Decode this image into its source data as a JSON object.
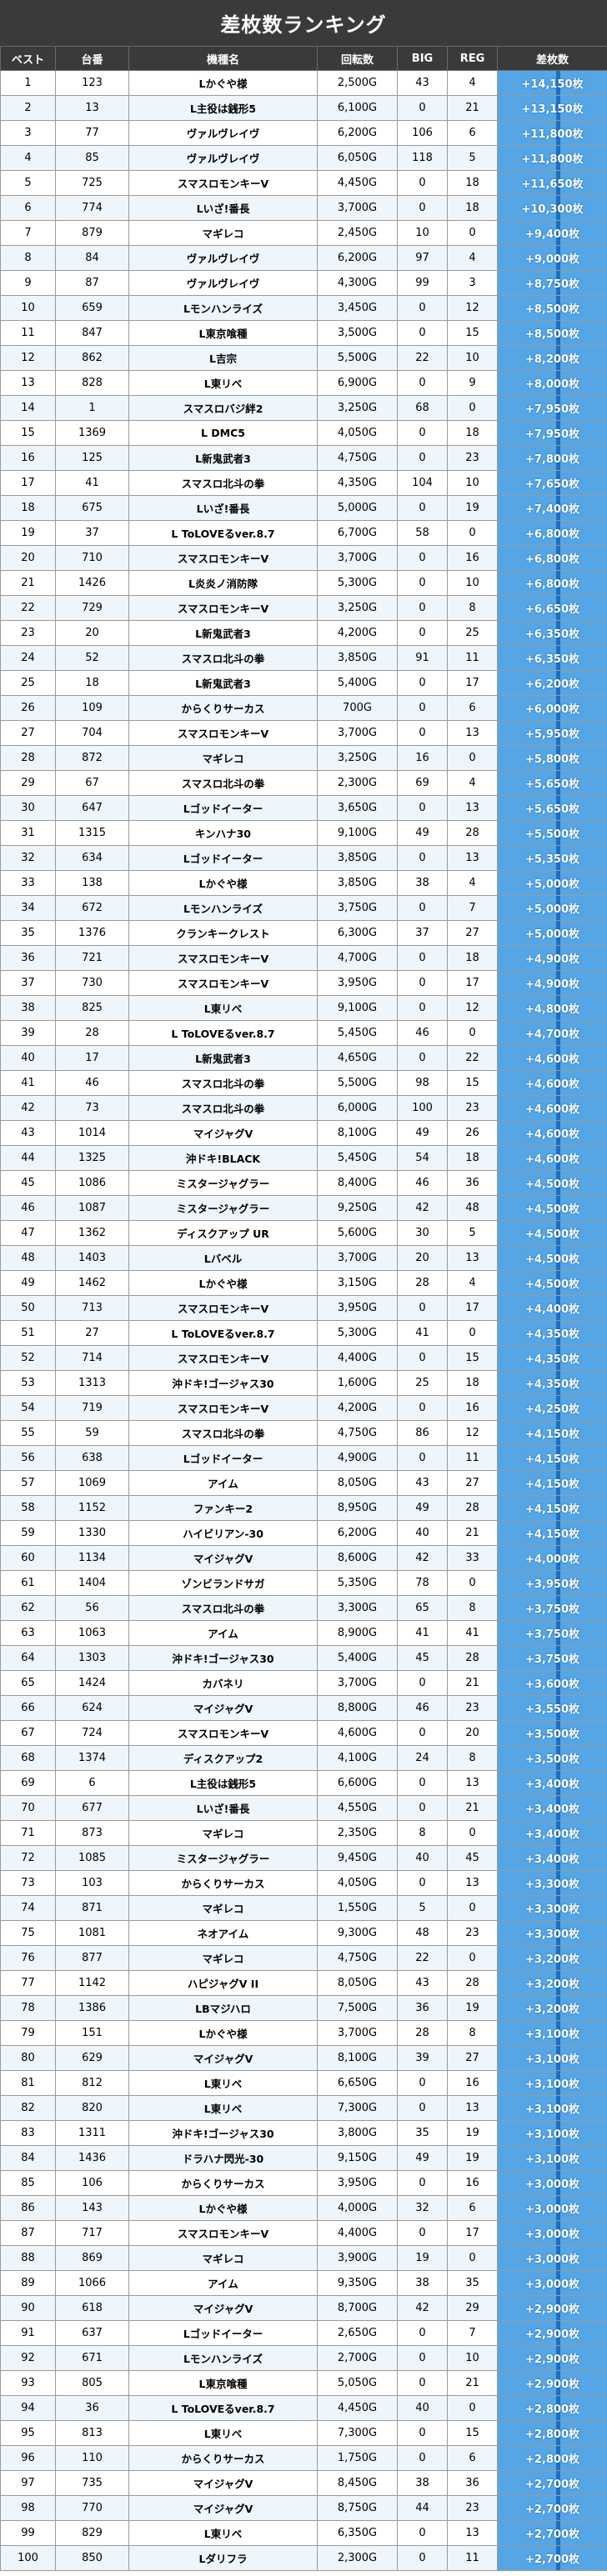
{
  "title": "差枚数ランキング",
  "headers": [
    "ベスト",
    "台番",
    "機種名",
    "回転数",
    "BIG",
    "REG",
    "差枚数"
  ],
  "colors": {
    "header_bg": "#3a3a3a",
    "diff_bg": "#56a6e6",
    "diff_marker": "#1f6fbf",
    "row_alt": "#eef5fb"
  },
  "rows": [
    [
      "1",
      "123",
      "Lかぐや様",
      "2,500G",
      "43",
      "4",
      "+14,150枚"
    ],
    [
      "2",
      "13",
      "L主役は銭形5",
      "6,100G",
      "0",
      "21",
      "+13,150枚"
    ],
    [
      "3",
      "77",
      "ヴァルヴレイヴ",
      "6,200G",
      "106",
      "6",
      "+11,800枚"
    ],
    [
      "4",
      "85",
      "ヴァルヴレイヴ",
      "6,050G",
      "118",
      "5",
      "+11,800枚"
    ],
    [
      "5",
      "725",
      "スマスロモンキーV",
      "4,450G",
      "0",
      "18",
      "+11,650枚"
    ],
    [
      "6",
      "774",
      "Lいざ!番長",
      "3,700G",
      "0",
      "18",
      "+10,300枚"
    ],
    [
      "7",
      "879",
      "マギレコ",
      "2,450G",
      "10",
      "0",
      "+9,400枚"
    ],
    [
      "8",
      "84",
      "ヴァルヴレイヴ",
      "6,200G",
      "97",
      "4",
      "+9,000枚"
    ],
    [
      "9",
      "87",
      "ヴァルヴレイヴ",
      "4,300G",
      "99",
      "3",
      "+8,750枚"
    ],
    [
      "10",
      "659",
      "Lモンハンライズ",
      "3,450G",
      "0",
      "12",
      "+8,500枚"
    ],
    [
      "11",
      "847",
      "L東京喰種",
      "3,500G",
      "0",
      "15",
      "+8,500枚"
    ],
    [
      "12",
      "862",
      "L吉宗",
      "5,500G",
      "22",
      "10",
      "+8,200枚"
    ],
    [
      "13",
      "828",
      "L東リベ",
      "6,900G",
      "0",
      "9",
      "+8,000枚"
    ],
    [
      "14",
      "1",
      "スマスロバジ絆2",
      "3,250G",
      "68",
      "0",
      "+7,950枚"
    ],
    [
      "15",
      "1369",
      "L DMC5",
      "4,050G",
      "0",
      "18",
      "+7,950枚"
    ],
    [
      "16",
      "125",
      "L新鬼武者3",
      "4,750G",
      "0",
      "23",
      "+7,800枚"
    ],
    [
      "17",
      "41",
      "スマスロ北斗の拳",
      "4,350G",
      "104",
      "10",
      "+7,650枚"
    ],
    [
      "18",
      "675",
      "Lいざ!番長",
      "5,000G",
      "0",
      "19",
      "+7,400枚"
    ],
    [
      "19",
      "37",
      "L ToLOVEるver.8.7",
      "6,700G",
      "58",
      "0",
      "+6,800枚"
    ],
    [
      "20",
      "710",
      "スマスロモンキーV",
      "3,700G",
      "0",
      "16",
      "+6,800枚"
    ],
    [
      "21",
      "1426",
      "L炎炎ノ消防隊",
      "5,300G",
      "0",
      "10",
      "+6,800枚"
    ],
    [
      "22",
      "729",
      "スマスロモンキーV",
      "3,250G",
      "0",
      "8",
      "+6,650枚"
    ],
    [
      "23",
      "20",
      "L新鬼武者3",
      "4,200G",
      "0",
      "25",
      "+6,350枚"
    ],
    [
      "24",
      "52",
      "スマスロ北斗の拳",
      "3,850G",
      "91",
      "11",
      "+6,350枚"
    ],
    [
      "25",
      "18",
      "L新鬼武者3",
      "5,400G",
      "0",
      "17",
      "+6,200枚"
    ],
    [
      "26",
      "109",
      "からくりサーカス",
      "700G",
      "0",
      "6",
      "+6,000枚"
    ],
    [
      "27",
      "704",
      "スマスロモンキーV",
      "3,700G",
      "0",
      "13",
      "+5,950枚"
    ],
    [
      "28",
      "872",
      "マギレコ",
      "3,250G",
      "16",
      "0",
      "+5,800枚"
    ],
    [
      "29",
      "67",
      "スマスロ北斗の拳",
      "2,300G",
      "69",
      "4",
      "+5,650枚"
    ],
    [
      "30",
      "647",
      "Lゴッドイーター",
      "3,650G",
      "0",
      "13",
      "+5,650枚"
    ],
    [
      "31",
      "1315",
      "キンハナ30",
      "9,100G",
      "49",
      "28",
      "+5,500枚"
    ],
    [
      "32",
      "634",
      "Lゴッドイーター",
      "3,850G",
      "0",
      "13",
      "+5,350枚"
    ],
    [
      "33",
      "138",
      "Lかぐや様",
      "3,850G",
      "38",
      "4",
      "+5,000枚"
    ],
    [
      "34",
      "672",
      "Lモンハンライズ",
      "3,750G",
      "0",
      "7",
      "+5,000枚"
    ],
    [
      "35",
      "1376",
      "クランキークレスト",
      "6,300G",
      "37",
      "27",
      "+5,000枚"
    ],
    [
      "36",
      "721",
      "スマスロモンキーV",
      "4,700G",
      "0",
      "18",
      "+4,900枚"
    ],
    [
      "37",
      "730",
      "スマスロモンキーV",
      "3,950G",
      "0",
      "17",
      "+4,900枚"
    ],
    [
      "38",
      "825",
      "L東リベ",
      "9,100G",
      "0",
      "12",
      "+4,800枚"
    ],
    [
      "39",
      "28",
      "L ToLOVEるver.8.7",
      "5,450G",
      "46",
      "0",
      "+4,700枚"
    ],
    [
      "40",
      "17",
      "L新鬼武者3",
      "4,650G",
      "0",
      "22",
      "+4,600枚"
    ],
    [
      "41",
      "46",
      "スマスロ北斗の拳",
      "5,500G",
      "98",
      "15",
      "+4,600枚"
    ],
    [
      "42",
      "73",
      "スマスロ北斗の拳",
      "6,000G",
      "100",
      "23",
      "+4,600枚"
    ],
    [
      "43",
      "1014",
      "マイジャグV",
      "8,100G",
      "49",
      "26",
      "+4,600枚"
    ],
    [
      "44",
      "1325",
      "沖ドキ!BLACK",
      "5,450G",
      "54",
      "18",
      "+4,600枚"
    ],
    [
      "45",
      "1086",
      "ミスタージャグラー",
      "8,400G",
      "46",
      "36",
      "+4,500枚"
    ],
    [
      "46",
      "1087",
      "ミスタージャグラー",
      "9,250G",
      "42",
      "48",
      "+4,500枚"
    ],
    [
      "47",
      "1362",
      "ディスクアップ UR",
      "5,600G",
      "30",
      "5",
      "+4,500枚"
    ],
    [
      "48",
      "1403",
      "Lバベル",
      "3,700G",
      "20",
      "13",
      "+4,500枚"
    ],
    [
      "49",
      "1462",
      "Lかぐや様",
      "3,150G",
      "28",
      "4",
      "+4,500枚"
    ],
    [
      "50",
      "713",
      "スマスロモンキーV",
      "3,950G",
      "0",
      "17",
      "+4,400枚"
    ],
    [
      "51",
      "27",
      "L ToLOVEるver.8.7",
      "5,300G",
      "41",
      "0",
      "+4,350枚"
    ],
    [
      "52",
      "714",
      "スマスロモンキーV",
      "4,400G",
      "0",
      "15",
      "+4,350枚"
    ],
    [
      "53",
      "1313",
      "沖ドキ!ゴージャス30",
      "1,600G",
      "25",
      "18",
      "+4,350枚"
    ],
    [
      "54",
      "719",
      "スマスロモンキーV",
      "4,200G",
      "0",
      "16",
      "+4,250枚"
    ],
    [
      "55",
      "59",
      "スマスロ北斗の拳",
      "4,750G",
      "86",
      "12",
      "+4,150枚"
    ],
    [
      "56",
      "638",
      "Lゴッドイーター",
      "4,900G",
      "0",
      "11",
      "+4,150枚"
    ],
    [
      "57",
      "1069",
      "アイム",
      "8,050G",
      "43",
      "27",
      "+4,150枚"
    ],
    [
      "58",
      "1152",
      "ファンキー2",
      "8,950G",
      "49",
      "28",
      "+4,150枚"
    ],
    [
      "59",
      "1330",
      "ハイビリアン-30",
      "6,200G",
      "40",
      "21",
      "+4,150枚"
    ],
    [
      "60",
      "1134",
      "マイジャグV",
      "8,600G",
      "42",
      "33",
      "+4,000枚"
    ],
    [
      "61",
      "1404",
      "ゾンビランドサガ",
      "5,350G",
      "78",
      "0",
      "+3,950枚"
    ],
    [
      "62",
      "56",
      "スマスロ北斗の拳",
      "3,300G",
      "65",
      "8",
      "+3,750枚"
    ],
    [
      "63",
      "1063",
      "アイム",
      "8,900G",
      "41",
      "41",
      "+3,750枚"
    ],
    [
      "64",
      "1303",
      "沖ドキ!ゴージャス30",
      "5,400G",
      "45",
      "28",
      "+3,750枚"
    ],
    [
      "65",
      "1424",
      "カバネリ",
      "3,700G",
      "0",
      "21",
      "+3,600枚"
    ],
    [
      "66",
      "624",
      "マイジャグV",
      "8,800G",
      "46",
      "23",
      "+3,550枚"
    ],
    [
      "67",
      "724",
      "スマスロモンキーV",
      "4,600G",
      "0",
      "20",
      "+3,500枚"
    ],
    [
      "68",
      "1374",
      "ディスクアップ2",
      "4,100G",
      "24",
      "8",
      "+3,500枚"
    ],
    [
      "69",
      "6",
      "L主役は銭形5",
      "6,600G",
      "0",
      "13",
      "+3,400枚"
    ],
    [
      "70",
      "677",
      "Lいざ!番長",
      "4,550G",
      "0",
      "21",
      "+3,400枚"
    ],
    [
      "71",
      "873",
      "マギレコ",
      "2,350G",
      "8",
      "0",
      "+3,400枚"
    ],
    [
      "72",
      "1085",
      "ミスタージャグラー",
      "9,450G",
      "40",
      "45",
      "+3,400枚"
    ],
    [
      "73",
      "103",
      "からくりサーカス",
      "4,050G",
      "0",
      "13",
      "+3,300枚"
    ],
    [
      "74",
      "871",
      "マギレコ",
      "1,550G",
      "5",
      "0",
      "+3,300枚"
    ],
    [
      "75",
      "1081",
      "ネオアイム",
      "9,300G",
      "48",
      "23",
      "+3,300枚"
    ],
    [
      "76",
      "877",
      "マギレコ",
      "4,750G",
      "22",
      "0",
      "+3,200枚"
    ],
    [
      "77",
      "1142",
      "ハピジャグV II",
      "8,050G",
      "43",
      "28",
      "+3,200枚"
    ],
    [
      "78",
      "1386",
      "LBマジハロ",
      "7,500G",
      "36",
      "19",
      "+3,200枚"
    ],
    [
      "79",
      "151",
      "Lかぐや様",
      "3,700G",
      "28",
      "8",
      "+3,100枚"
    ],
    [
      "80",
      "629",
      "マイジャグV",
      "8,100G",
      "39",
      "27",
      "+3,100枚"
    ],
    [
      "81",
      "812",
      "L東リベ",
      "6,650G",
      "0",
      "16",
      "+3,100枚"
    ],
    [
      "82",
      "820",
      "L東リベ",
      "7,300G",
      "0",
      "13",
      "+3,100枚"
    ],
    [
      "83",
      "1311",
      "沖ドキ!ゴージャス30",
      "3,800G",
      "35",
      "19",
      "+3,100枚"
    ],
    [
      "84",
      "1436",
      "ドラハナ閃光-30",
      "9,150G",
      "49",
      "19",
      "+3,100枚"
    ],
    [
      "85",
      "106",
      "からくりサーカス",
      "3,950G",
      "0",
      "16",
      "+3,000枚"
    ],
    [
      "86",
      "143",
      "Lかぐや様",
      "4,000G",
      "32",
      "6",
      "+3,000枚"
    ],
    [
      "87",
      "717",
      "スマスロモンキーV",
      "4,400G",
      "0",
      "17",
      "+3,000枚"
    ],
    [
      "88",
      "869",
      "マギレコ",
      "3,900G",
      "19",
      "0",
      "+3,000枚"
    ],
    [
      "89",
      "1066",
      "アイム",
      "9,350G",
      "38",
      "35",
      "+3,000枚"
    ],
    [
      "90",
      "618",
      "マイジャグV",
      "8,700G",
      "42",
      "29",
      "+2,900枚"
    ],
    [
      "91",
      "637",
      "Lゴッドイーター",
      "2,650G",
      "0",
      "7",
      "+2,900枚"
    ],
    [
      "92",
      "671",
      "Lモンハンライズ",
      "2,700G",
      "0",
      "10",
      "+2,900枚"
    ],
    [
      "93",
      "805",
      "L東京喰種",
      "5,050G",
      "0",
      "21",
      "+2,900枚"
    ],
    [
      "94",
      "36",
      "L ToLOVEるver.8.7",
      "4,450G",
      "40",
      "0",
      "+2,800枚"
    ],
    [
      "95",
      "813",
      "L東リベ",
      "7,300G",
      "0",
      "15",
      "+2,800枚"
    ],
    [
      "96",
      "110",
      "からくりサーカス",
      "1,750G",
      "0",
      "6",
      "+2,800枚"
    ],
    [
      "97",
      "735",
      "マイジャグV",
      "8,450G",
      "38",
      "36",
      "+2,700枚"
    ],
    [
      "98",
      "770",
      "マイジャグV",
      "8,750G",
      "44",
      "23",
      "+2,700枚"
    ],
    [
      "99",
      "829",
      "L東リベ",
      "6,350G",
      "0",
      "13",
      "+2,700枚"
    ],
    [
      "100",
      "850",
      "Lダリフラ",
      "2,300G",
      "0",
      "11",
      "+2,700枚"
    ]
  ]
}
